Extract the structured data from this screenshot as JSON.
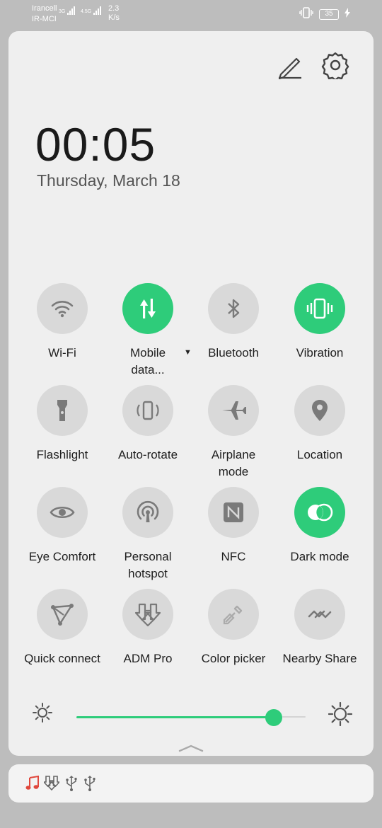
{
  "status_bar": {
    "carrier_1": "Irancell",
    "carrier_2": "IR-MCI",
    "network_1": "3G",
    "network_2": "4.5G",
    "speed_value": "2.3",
    "speed_unit": "K/s",
    "battery_level": "35",
    "icons": [
      "vibrate-icon",
      "battery-icon",
      "charging-icon"
    ]
  },
  "header": {
    "edit_icon": "pencil-icon",
    "settings_icon": "gear-icon"
  },
  "clock": {
    "time": "00:05",
    "date": "Thursday, March 18"
  },
  "quick_settings": {
    "tiles": [
      {
        "label": "Wi-Fi",
        "icon": "wifi-icon",
        "active": false
      },
      {
        "label": "Mobile data...",
        "icon": "mobile-data-icon",
        "active": true
      },
      {
        "label": "Bluetooth",
        "icon": "bluetooth-icon",
        "active": false
      },
      {
        "label": "Vibration",
        "icon": "vibration-icon",
        "active": true
      },
      {
        "label": "Flashlight",
        "icon": "flashlight-icon",
        "active": false
      },
      {
        "label": "Auto-rotate",
        "icon": "auto-rotate-icon",
        "active": false
      },
      {
        "label": "Airplane mode",
        "icon": "airplane-icon",
        "active": false
      },
      {
        "label": "Location",
        "icon": "location-pin-icon",
        "active": false
      },
      {
        "label": "Eye Comfort",
        "icon": "eye-icon",
        "active": false
      },
      {
        "label": "Personal hotspot",
        "icon": "hotspot-icon",
        "active": false
      },
      {
        "label": "NFC",
        "icon": "nfc-icon",
        "active": false
      },
      {
        "label": "Dark mode",
        "icon": "dark-mode-icon",
        "active": true
      },
      {
        "label": "Quick connect",
        "icon": "quick-connect-icon",
        "active": false
      },
      {
        "label": "ADM Pro",
        "icon": "download-icon",
        "active": false
      },
      {
        "label": "Color picker",
        "icon": "eyedropper-icon",
        "active": false
      },
      {
        "label": "Nearby Share",
        "icon": "nearby-share-icon",
        "active": false
      }
    ]
  },
  "brightness": {
    "level_fraction": 0.89,
    "low_icon": "sun-small-icon",
    "high_icon": "sun-large-icon"
  },
  "colors": {
    "accent": "#2ecc7a",
    "tile_off": "#d9d9d9",
    "panel": "#efefef"
  },
  "notifications": {
    "icons": [
      "music-note-icon",
      "download-icon",
      "usb-icon",
      "usb-icon"
    ]
  }
}
